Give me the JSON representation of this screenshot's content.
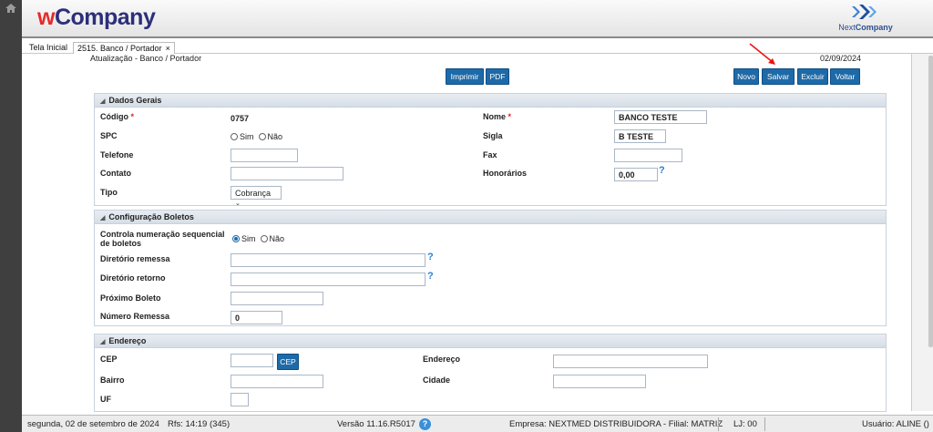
{
  "header": {
    "brand_w": "w",
    "brand_rest": "Company",
    "logo_prefix": "Next",
    "logo_suffix": "Company"
  },
  "tabs": [
    {
      "label": "Tela Inicial"
    },
    {
      "label": "2515. Banco / Portador",
      "close": "×"
    }
  ],
  "page": {
    "title": "Atualização - Banco / Portador",
    "date": "02/09/2024"
  },
  "toolbar": {
    "imprimir": "Imprimir",
    "pdf": "PDF",
    "novo": "Novo",
    "salvar": "Salvar",
    "excluir": "Excluir",
    "voltar": "Voltar"
  },
  "dados_gerais": {
    "title": "Dados Gerais",
    "codigo_label": "Código",
    "codigo_value": "0757",
    "spc_label": "SPC",
    "sim": "Sim",
    "nao": "Não",
    "spc_selected": "none",
    "telefone_label": "Telefone",
    "telefone_value": "",
    "contato_label": "Contato",
    "contato_value": "",
    "tipo_label": "Tipo",
    "tipo_value": "Cobrança",
    "nome_label": "Nome",
    "nome_value": "BANCO TESTE",
    "sigla_label": "Sigla",
    "sigla_value": "B TESTE",
    "fax_label": "Fax",
    "fax_value": "",
    "honorarios_label": "Honorários",
    "honorarios_value": "0,00",
    "required_mark": "*"
  },
  "boletos": {
    "title": "Configuração Boletos",
    "controla_label_1": "Controla numeração sequencial",
    "controla_label_2": "de boletos",
    "controla_selected": "Sim",
    "sim": "Sim",
    "nao": "Não",
    "remessa_label": "Diretório remessa",
    "remessa_value": "",
    "retorno_label": "Diretório retorno",
    "retorno_value": "",
    "proximo_label": "Próximo Boleto",
    "proximo_value": "",
    "numero_label": "Número Remessa",
    "numero_value": "0"
  },
  "endereco": {
    "title": "Endereço",
    "cep_label": "CEP",
    "cep_value": "",
    "cep_button": "CEP",
    "bairro_label": "Bairro",
    "bairro_value": "",
    "uf_label": "UF",
    "uf_value": "",
    "endereco_label": "Endereço",
    "endereco_value": "",
    "cidade_label": "Cidade",
    "cidade_value": ""
  },
  "status": {
    "date": "segunda, 02 de setembro de 2024",
    "rfs": "Rfs: 14:19 (345)",
    "versao": "Versão 11.16.R5017",
    "empresa": "Empresa: NEXTMED DISTRIBUIDORA - Filial: MATRIZ",
    "lj": "LJ: 00",
    "usuario": "Usuário: ALINE ()"
  },
  "colors": {
    "button": "#1e6aa8",
    "required": "#dd2222",
    "help": "#2a7fd0",
    "annotation_arrow": "#e11"
  },
  "icons": {
    "home": "home-icon",
    "help": "help-icon",
    "logo": "nextcompany-logo-icon"
  }
}
